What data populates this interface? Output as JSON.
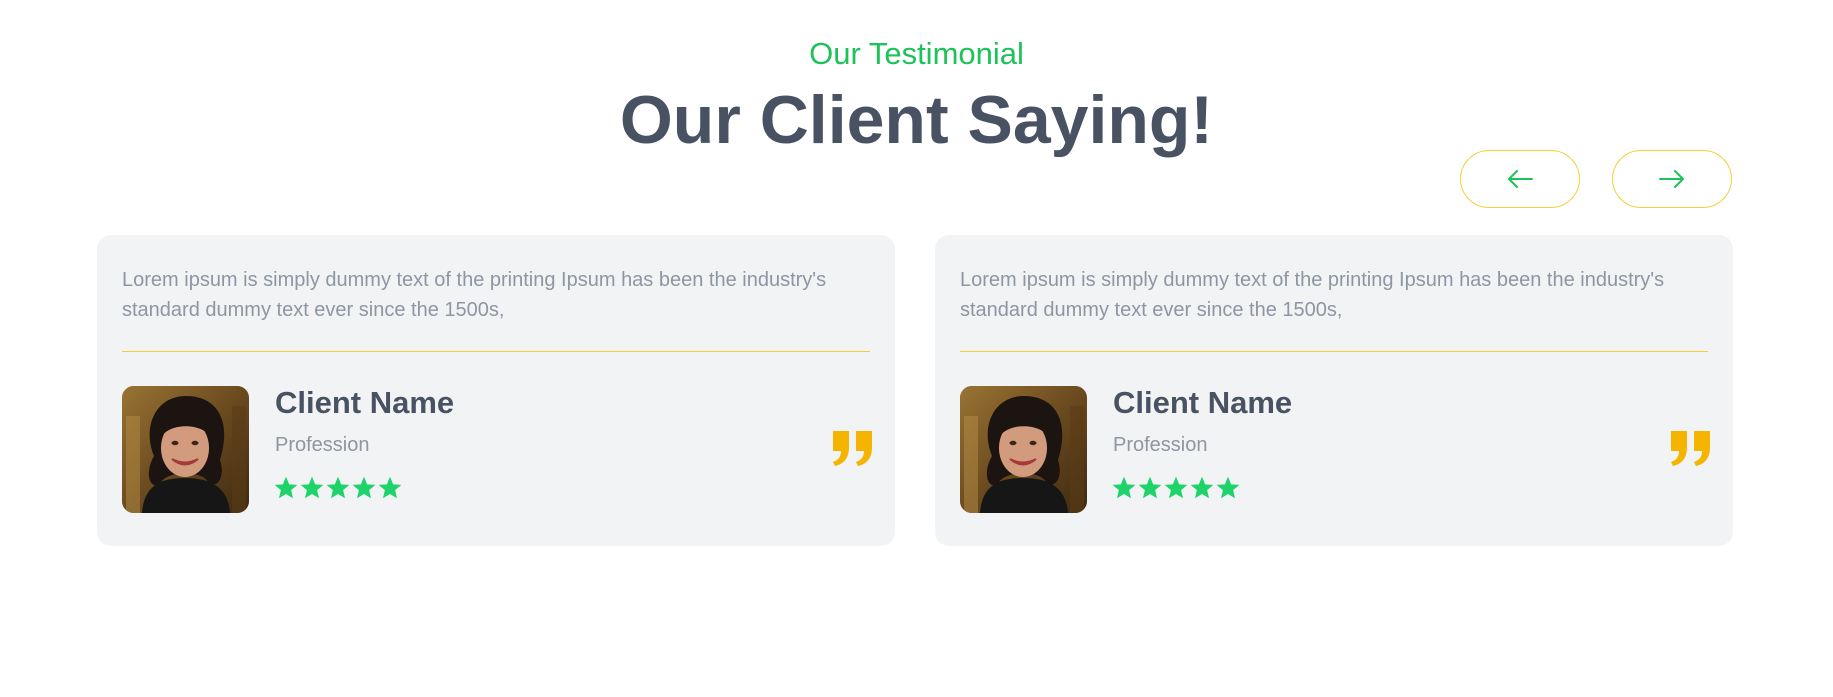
{
  "section": {
    "eyebrow": "Our Testimonial",
    "headline": "Our Client Saying!"
  },
  "navigation": {
    "prev_icon": "arrow-left-icon",
    "next_icon": "arrow-right-icon"
  },
  "testimonials": [
    {
      "text": "Lorem ipsum is simply dummy text of the printing Ipsum has been the industry's standard dummy text ever since the 1500s,",
      "name": "Client Name",
      "profession": "Profession",
      "rating": 5,
      "avatar": "client-photo",
      "quote_icon": "quote-icon"
    },
    {
      "text": "Lorem ipsum is simply dummy text of the printing Ipsum has been the industry's standard dummy text ever since the 1500s,",
      "name": "Client Name",
      "profession": "Profession",
      "rating": 5,
      "avatar": "client-photo",
      "quote_icon": "quote-icon"
    }
  ],
  "colors": {
    "accent_green": "#1ec25a",
    "star_green": "#1ed36a",
    "quote_yellow": "#f4b400",
    "border_yellow": "#f3cf3b",
    "heading": "#485263",
    "muted_text": "#8e96a3",
    "card_bg": "#f2f3f5"
  }
}
